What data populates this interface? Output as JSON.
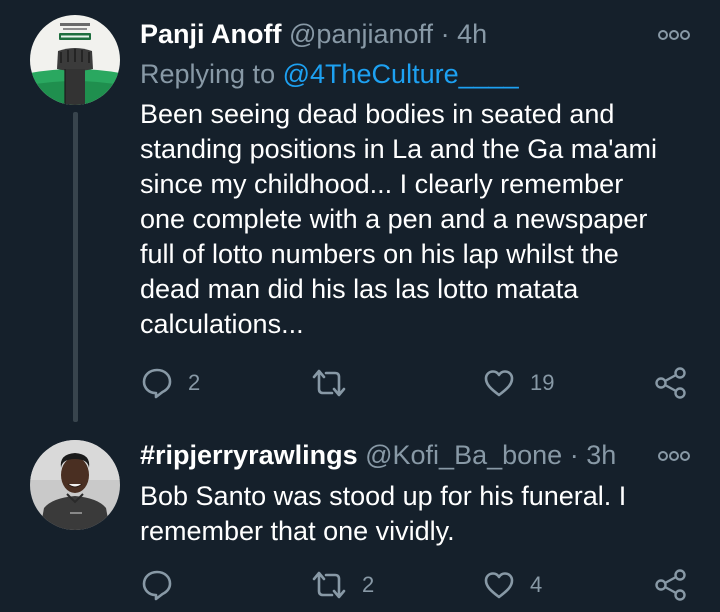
{
  "colors": {
    "background": "#15202b",
    "text_primary": "#ffffff",
    "text_secondary": "#8899a6",
    "link": "#1da1f2",
    "thread_line": "#38444d"
  },
  "tweets": [
    {
      "display_name": "Panji Anoff",
      "handle": "@panjianoff",
      "separator": "·",
      "time": "4h",
      "replying_prefix": "Replying to",
      "replying_to": "@4TheCulture____",
      "text": "Been seeing dead bodies in seated and\nstanding positions in La and the Ga ma'ami\nsince my childhood... I clearly remember\none complete with a pen and a newspaper\nfull of lotto numbers on his lap whilst the\ndead man did his las las lotto matata\ncalculations...",
      "avatar": {
        "icon": "raised-fist-icon",
        "badge_text": "#EndSars",
        "caption_text": "NIGERIAN LIVES MATTER"
      },
      "actions": {
        "reply_icon": "reply-icon",
        "reply_count": "2",
        "retweet_icon": "retweet-icon",
        "retweet_count": "",
        "like_icon": "heart-icon",
        "like_count": "19",
        "share_icon": "share-icon"
      }
    },
    {
      "display_name": "#ripjerryrawlings",
      "handle": "@Kofi_Ba_bone",
      "separator": "·",
      "time": "3h",
      "text": "Bob Santo was stood up for his funeral. I\nremember that one vividly.",
      "avatar": {
        "icon": "person-photo-icon"
      },
      "actions": {
        "reply_icon": "reply-icon",
        "reply_count": "",
        "retweet_icon": "retweet-icon",
        "retweet_count": "2",
        "like_icon": "heart-icon",
        "like_count": "4",
        "share_icon": "share-icon"
      }
    }
  ]
}
